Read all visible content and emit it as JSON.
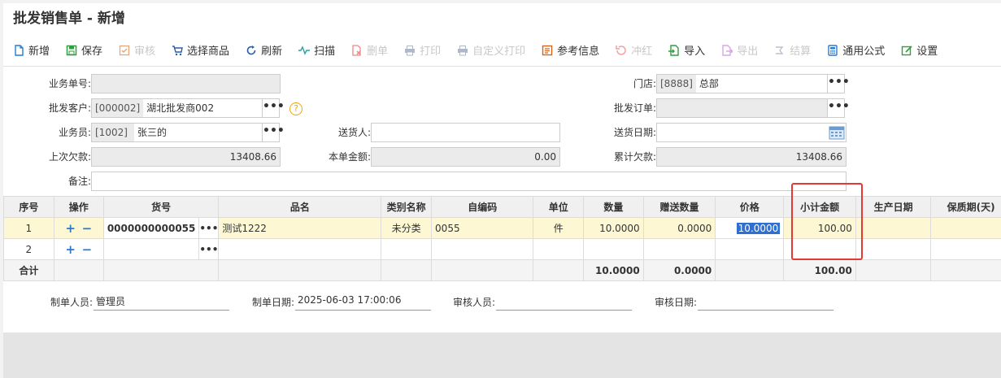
{
  "window": {
    "title": "批发销售单 - 新增"
  },
  "toolbar": [
    {
      "label": "新增",
      "icon": "new-doc-icon",
      "enabled": true
    },
    {
      "label": "保存",
      "icon": "save-icon",
      "enabled": true
    },
    {
      "label": "审核",
      "icon": "approve-icon",
      "enabled": false
    },
    {
      "label": "选择商品",
      "icon": "cart-icon",
      "enabled": true
    },
    {
      "label": "刷新",
      "icon": "refresh-icon",
      "enabled": true
    },
    {
      "label": "扫描",
      "icon": "scan-icon",
      "enabled": true
    },
    {
      "label": "删单",
      "icon": "delete-doc-icon",
      "enabled": false
    },
    {
      "label": "打印",
      "icon": "print-icon",
      "enabled": false
    },
    {
      "label": "自定义打印",
      "icon": "custom-print-icon",
      "enabled": false
    },
    {
      "label": "参考信息",
      "icon": "reference-icon",
      "enabled": true
    },
    {
      "label": "冲红",
      "icon": "reverse-icon",
      "enabled": false
    },
    {
      "label": "导入",
      "icon": "import-icon",
      "enabled": true
    },
    {
      "label": "导出",
      "icon": "export-icon",
      "enabled": false
    },
    {
      "label": "结算",
      "icon": "settle-icon",
      "enabled": false
    },
    {
      "label": "通用公式",
      "icon": "calculator-icon",
      "enabled": true
    },
    {
      "label": "设置",
      "icon": "settings-icon",
      "enabled": true
    }
  ],
  "form": {
    "order_no": {
      "label": "业务单号:",
      "value": ""
    },
    "customer": {
      "label": "批发客户:",
      "code": "[000002]",
      "value": "湖北批发商002"
    },
    "salesman": {
      "label": "业务员:",
      "code": "[1002]",
      "value": "张三的"
    },
    "last_debt": {
      "label": "上次欠款:",
      "value": "13408.66"
    },
    "remark": {
      "label": "备注:",
      "value": ""
    },
    "delivery_person": {
      "label": "送货人:",
      "value": ""
    },
    "this_amount": {
      "label": "本单金额:",
      "value": "0.00"
    },
    "store": {
      "label": "门店:",
      "code": "[8888]",
      "value": "总部"
    },
    "wholesale_order": {
      "label": "批发订单:",
      "value": ""
    },
    "delivery_date": {
      "label": "送货日期:",
      "value": ""
    },
    "total_debt": {
      "label": "累计欠款:",
      "value": "13408.66"
    },
    "help_glyph": "?",
    "dots_glyph": "•••"
  },
  "grid": {
    "headers": [
      "序号",
      "操作",
      "货号",
      "品名",
      "类别名称",
      "自编码",
      "单位",
      "数量",
      "赠送数量",
      "价格",
      "小计金额",
      "生产日期",
      "保质期(天)"
    ],
    "rows": [
      {
        "seq": "1",
        "sku": "0000000000055",
        "name": "测试1222",
        "category": "未分类",
        "selfcode": "0055",
        "unit": "件",
        "qty": "10.0000",
        "gift_qty": "0.0000",
        "price": "10.0000",
        "subtotal": "100.00",
        "prod_date": "",
        "shelf_life": ""
      },
      {
        "seq": "2",
        "sku": "",
        "name": "",
        "category": "",
        "selfcode": "",
        "unit": "",
        "qty": "",
        "gift_qty": "",
        "price": "",
        "subtotal": "",
        "prod_date": "",
        "shelf_life": ""
      }
    ],
    "summary": {
      "label": "合计",
      "qty": "10.0000",
      "gift_qty": "0.0000",
      "subtotal": "100.00"
    },
    "add_glyph": "+",
    "remove_glyph": "−"
  },
  "footer": {
    "creator": {
      "label": "制单人员:",
      "value": "管理员"
    },
    "create_date": {
      "label": "制单日期:",
      "value": "2025-06-03 17:00:06"
    },
    "auditor": {
      "label": "审核人员:",
      "value": ""
    },
    "audit_date": {
      "label": "审核日期:",
      "value": ""
    }
  },
  "colors": {
    "accent": "#2a7ad0",
    "highlight_box": "#e53935",
    "selected_row": "#fdf8d3"
  }
}
